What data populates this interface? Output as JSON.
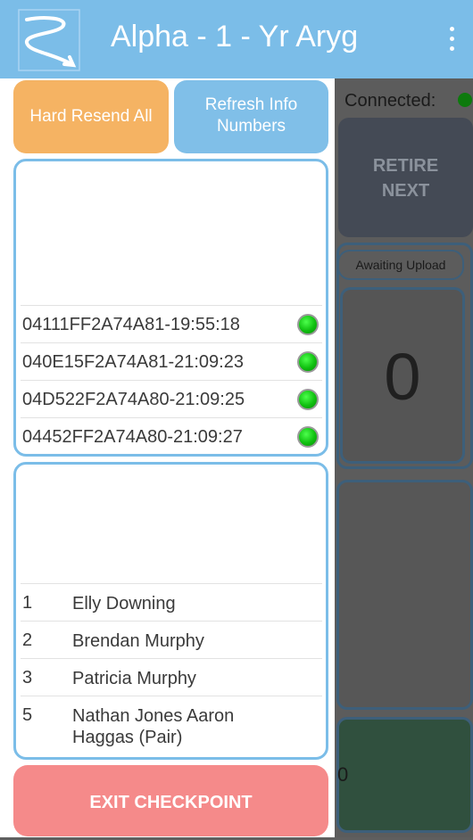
{
  "header": {
    "title": "Alpha - 1 - Yr Aryg"
  },
  "background": {
    "connected_label": "Connected:",
    "retire_label_line1": "RETIRE",
    "retire_label_line2": "NEXT",
    "awaiting_label": "Awaiting Upload",
    "count_value": "0",
    "bottom_value": "0"
  },
  "drawer": {
    "hard_resend_label": "Hard Resend All",
    "refresh_label_line1": "Refresh Info",
    "refresh_label_line2": "Numbers",
    "devices": [
      {
        "id": "04111FF2A74A81-19:55:18",
        "status": "green"
      },
      {
        "id": "040E15F2A74A81-21:09:23",
        "status": "green"
      },
      {
        "id": "04D522F2A74A80-21:09:25",
        "status": "green"
      },
      {
        "id": "04452FF2A74A80-21:09:27",
        "status": "green"
      }
    ],
    "participants": [
      {
        "number": "1",
        "name": "Elly Downing"
      },
      {
        "number": "2",
        "name": "Brendan Murphy"
      },
      {
        "number": "3",
        "name": "Patricia Murphy"
      },
      {
        "number": "5",
        "name": "Nathan Jones Aaron Haggas (Pair)"
      }
    ],
    "exit_label": "EXIT CHECKPOINT"
  },
  "colors": {
    "appbar": "#7bbde8",
    "orange": "#f5b363",
    "exit": "#f58a8a"
  }
}
